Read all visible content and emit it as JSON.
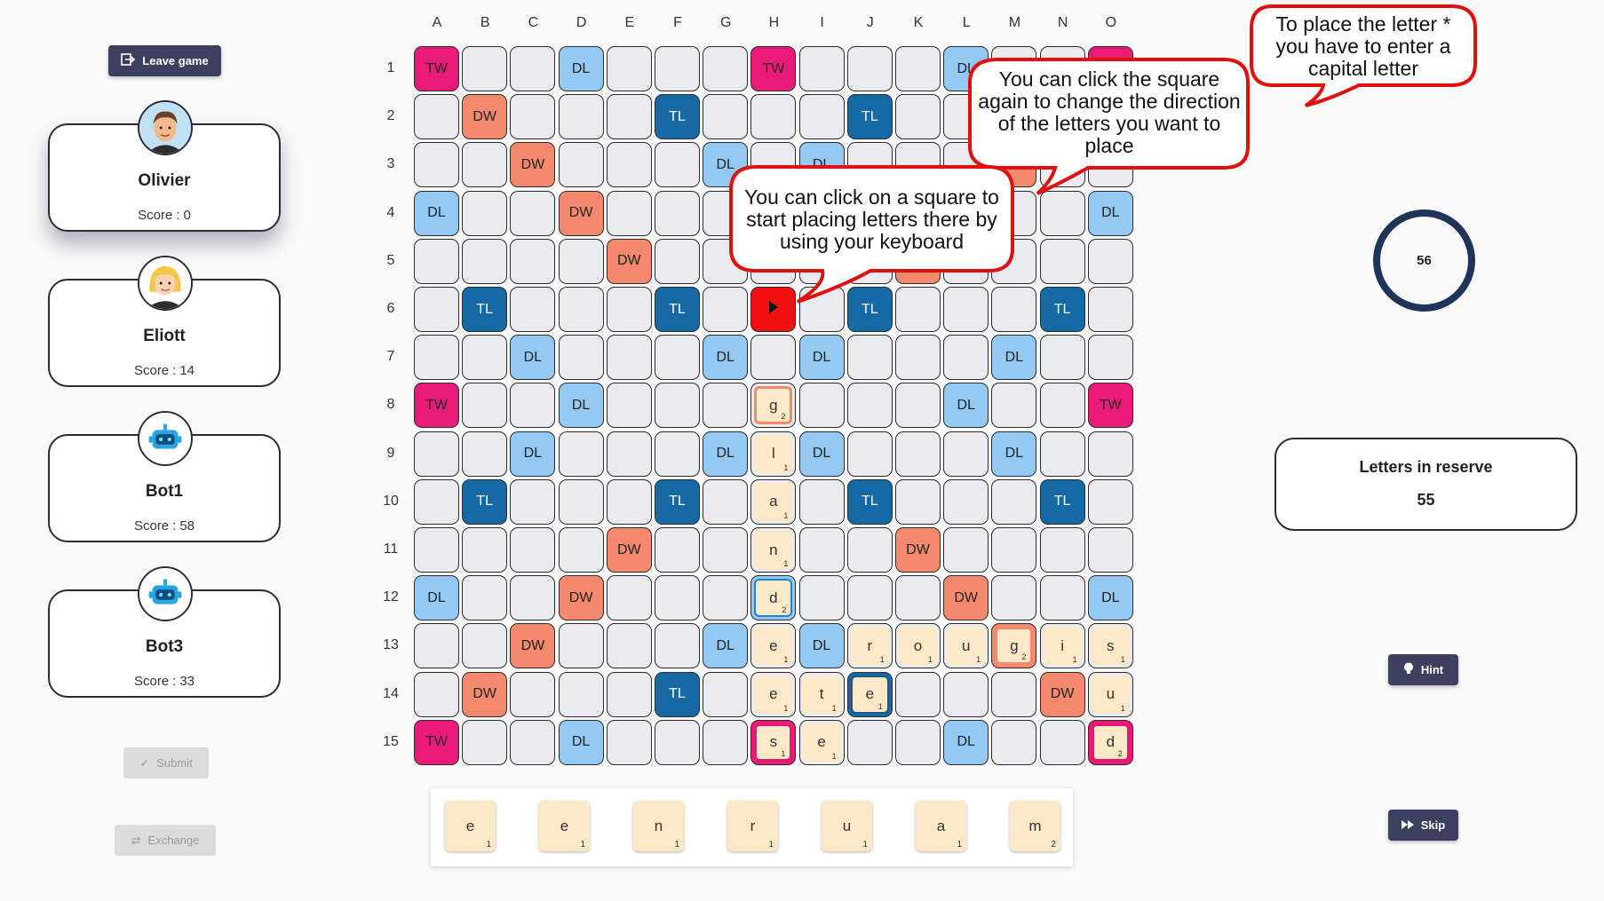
{
  "toolbar": {
    "leave_label": "Leave game"
  },
  "icons": {
    "leave": "exit-door-icon",
    "submit": "check-icon",
    "exchange": "swap-arrows-icon",
    "hint": "lightbulb-icon",
    "skip": "fast-forward-icon"
  },
  "colors": {
    "TW": "#ea1b78",
    "DW": "#f4896d",
    "TL": "#156aa6",
    "DL": "#93c9f2",
    "cursor": "#f20f0f",
    "tile": "#fbe8c6",
    "button": "#3d3f5e"
  },
  "players": [
    {
      "name": "Olivier",
      "score_label": "Score",
      "score": "0",
      "avatar": "man-avatar",
      "active": true
    },
    {
      "name": "Eliott",
      "score_label": "Score",
      "score": "14",
      "avatar": "woman-avatar",
      "active": false
    },
    {
      "name": "Bot1",
      "score_label": "Score",
      "score": "58",
      "avatar": "robot-avatar",
      "active": false
    },
    {
      "name": "Bot3",
      "score_label": "Score",
      "score": "33",
      "avatar": "robot-avatar",
      "active": false
    }
  ],
  "actions": {
    "submit_label": "Submit",
    "exchange_label": "Exchange",
    "hint_label": "Hint",
    "skip_label": "Skip"
  },
  "board": {
    "columns": [
      "A",
      "B",
      "C",
      "D",
      "E",
      "F",
      "G",
      "H",
      "I",
      "J",
      "K",
      "L",
      "M",
      "N",
      "O"
    ],
    "rows": [
      "1",
      "2",
      "3",
      "4",
      "5",
      "6",
      "7",
      "8",
      "9",
      "10",
      "11",
      "12",
      "13",
      "14",
      "15"
    ],
    "premiums": [
      {
        "cell": "A1",
        "type": "TW"
      },
      {
        "cell": "H1",
        "type": "TW"
      },
      {
        "cell": "O1",
        "type": "TW"
      },
      {
        "cell": "A8",
        "type": "TW"
      },
      {
        "cell": "O8",
        "type": "TW"
      },
      {
        "cell": "A15",
        "type": "TW"
      },
      {
        "cell": "H15",
        "type": "TW"
      },
      {
        "cell": "O15",
        "type": "TW"
      },
      {
        "cell": "B2",
        "type": "DW"
      },
      {
        "cell": "N2",
        "type": "DW"
      },
      {
        "cell": "C3",
        "type": "DW"
      },
      {
        "cell": "M3",
        "type": "DW"
      },
      {
        "cell": "D4",
        "type": "DW"
      },
      {
        "cell": "L4",
        "type": "DW"
      },
      {
        "cell": "E5",
        "type": "DW"
      },
      {
        "cell": "K5",
        "type": "DW"
      },
      {
        "cell": "E11",
        "type": "DW"
      },
      {
        "cell": "K11",
        "type": "DW"
      },
      {
        "cell": "D12",
        "type": "DW"
      },
      {
        "cell": "L12",
        "type": "DW"
      },
      {
        "cell": "C13",
        "type": "DW"
      },
      {
        "cell": "M13",
        "type": "DW"
      },
      {
        "cell": "B14",
        "type": "DW"
      },
      {
        "cell": "N14",
        "type": "DW"
      },
      {
        "cell": "F2",
        "type": "TL"
      },
      {
        "cell": "J2",
        "type": "TL"
      },
      {
        "cell": "B6",
        "type": "TL"
      },
      {
        "cell": "F6",
        "type": "TL"
      },
      {
        "cell": "J6",
        "type": "TL"
      },
      {
        "cell": "N6",
        "type": "TL"
      },
      {
        "cell": "B10",
        "type": "TL"
      },
      {
        "cell": "F10",
        "type": "TL"
      },
      {
        "cell": "J10",
        "type": "TL"
      },
      {
        "cell": "N10",
        "type": "TL"
      },
      {
        "cell": "F14",
        "type": "TL"
      },
      {
        "cell": "J14",
        "type": "TL"
      },
      {
        "cell": "D1",
        "type": "DL"
      },
      {
        "cell": "L1",
        "type": "DL"
      },
      {
        "cell": "G3",
        "type": "DL"
      },
      {
        "cell": "I3",
        "type": "DL"
      },
      {
        "cell": "A4",
        "type": "DL"
      },
      {
        "cell": "H4",
        "type": "DL"
      },
      {
        "cell": "O4",
        "type": "DL"
      },
      {
        "cell": "C7",
        "type": "DL"
      },
      {
        "cell": "G7",
        "type": "DL"
      },
      {
        "cell": "I7",
        "type": "DL"
      },
      {
        "cell": "M7",
        "type": "DL"
      },
      {
        "cell": "D8",
        "type": "DL"
      },
      {
        "cell": "L8",
        "type": "DL"
      },
      {
        "cell": "C9",
        "type": "DL"
      },
      {
        "cell": "G9",
        "type": "DL"
      },
      {
        "cell": "I9",
        "type": "DL"
      },
      {
        "cell": "M9",
        "type": "DL"
      },
      {
        "cell": "A12",
        "type": "DL"
      },
      {
        "cell": "H12",
        "type": "DL"
      },
      {
        "cell": "O12",
        "type": "DL"
      },
      {
        "cell": "G13",
        "type": "DL"
      },
      {
        "cell": "I13",
        "type": "DL"
      },
      {
        "cell": "D15",
        "type": "DL"
      },
      {
        "cell": "L15",
        "type": "DL"
      }
    ],
    "cursor": {
      "cell": "H6",
      "direction": "right",
      "icon": "play-arrow-icon"
    },
    "tiles": [
      {
        "cell": "H8",
        "letter": "g",
        "points": "2",
        "highlight": "orange"
      },
      {
        "cell": "H9",
        "letter": "l",
        "points": "1",
        "highlight": "plain"
      },
      {
        "cell": "H10",
        "letter": "a",
        "points": "1",
        "highlight": "plain"
      },
      {
        "cell": "H11",
        "letter": "n",
        "points": "1",
        "highlight": "plain"
      },
      {
        "cell": "H12",
        "letter": "d",
        "points": "2",
        "highlight": "blue"
      },
      {
        "cell": "H13",
        "letter": "e",
        "points": "1",
        "highlight": "plain"
      },
      {
        "cell": "J13",
        "letter": "r",
        "points": "1",
        "highlight": "plain"
      },
      {
        "cell": "K13",
        "letter": "o",
        "points": "1",
        "highlight": "plain"
      },
      {
        "cell": "L13",
        "letter": "u",
        "points": "1",
        "highlight": "plain"
      },
      {
        "cell": "M13",
        "letter": "g",
        "points": "2",
        "highlight": "orange"
      },
      {
        "cell": "N13",
        "letter": "i",
        "points": "1",
        "highlight": "plain"
      },
      {
        "cell": "O13",
        "letter": "s",
        "points": "1",
        "highlight": "plain"
      },
      {
        "cell": "H14",
        "letter": "e",
        "points": "1",
        "highlight": "plain"
      },
      {
        "cell": "I14",
        "letter": "t",
        "points": "1",
        "highlight": "plain"
      },
      {
        "cell": "J14",
        "letter": "e",
        "points": "1",
        "highlight": "navy"
      },
      {
        "cell": "O14",
        "letter": "u",
        "points": "1",
        "highlight": "plain"
      },
      {
        "cell": "H15",
        "letter": "s",
        "points": "1",
        "highlight": "pink"
      },
      {
        "cell": "I15",
        "letter": "e",
        "points": "1",
        "highlight": "plain"
      },
      {
        "cell": "O15",
        "letter": "d",
        "points": "2",
        "highlight": "pink"
      }
    ]
  },
  "rack": [
    {
      "letter": "e",
      "points": "1"
    },
    {
      "letter": "e",
      "points": "1"
    },
    {
      "letter": "n",
      "points": "1"
    },
    {
      "letter": "r",
      "points": "1"
    },
    {
      "letter": "u",
      "points": "1"
    },
    {
      "letter": "a",
      "points": "1"
    },
    {
      "letter": "m",
      "points": "2"
    }
  ],
  "timer": {
    "value": "56"
  },
  "reserve": {
    "title": "Letters in reserve",
    "count": "55"
  },
  "callouts": {
    "capital": [
      "To place the letter *",
      "you have to enter a",
      "capital letter"
    ],
    "direction": [
      "You can click the square",
      "again to change the direction",
      "of the letters you want to",
      "place"
    ],
    "start": [
      "You can click on a square to",
      "start placing letters there by",
      "using your keyboard"
    ]
  }
}
